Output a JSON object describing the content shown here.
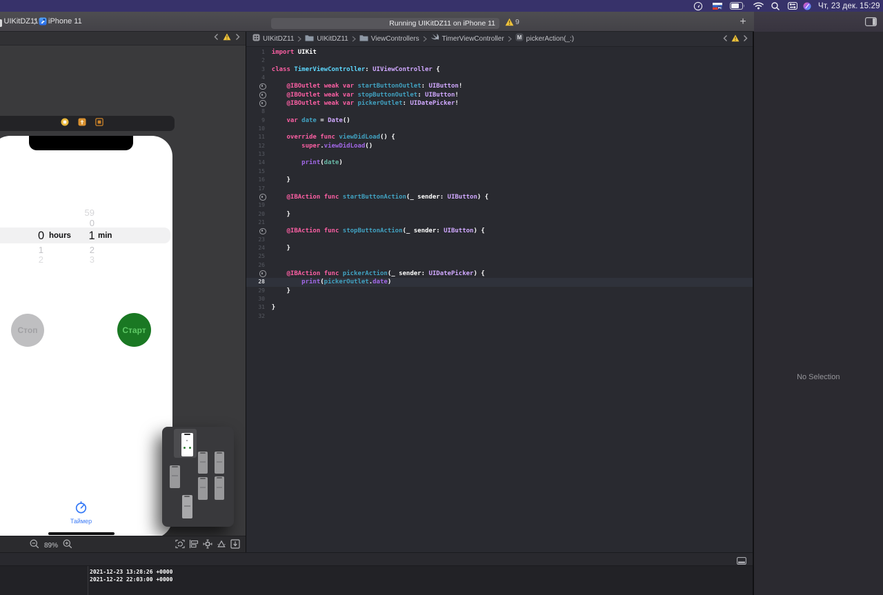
{
  "menubar": {
    "date": "Чт, 23 дек.",
    "time": "15:29",
    "flag_badge": "РС",
    "icons": [
      "location-icon",
      "input-flag-icon",
      "battery-icon",
      "wifi-icon",
      "spotlight-icon",
      "control-center-icon",
      "color-app-icon"
    ]
  },
  "toolbar": {
    "scheme": "UIKitDZ11",
    "device": "iPhone 11",
    "status": "Running UIKitDZ11 on iPhone 11",
    "warning_count": "9",
    "add_label": "+"
  },
  "ib": {
    "zoom": "89%",
    "scene": {
      "picker": {
        "hours_selected": "0",
        "hours_label": "hours",
        "minutes_selected": "1",
        "minutes_label": "min",
        "minutes_above": [
          "59",
          "0"
        ],
        "hours_below": [
          "1",
          "2"
        ],
        "minutes_below": [
          "2",
          "3"
        ]
      },
      "stop_label": "Стоп",
      "start_label": "Старт",
      "tab_label": "Таймер"
    }
  },
  "editor": {
    "breadcrumbs": [
      {
        "icon": "app-icon",
        "label": "UIKitDZ11"
      },
      {
        "icon": "folder-icon",
        "label": "UIKitDZ11"
      },
      {
        "icon": "folder-icon",
        "label": "ViewControllers"
      },
      {
        "icon": "swift-icon",
        "label": "TimerViewController"
      },
      {
        "icon": "method-icon",
        "label": "pickerAction(_:)",
        "badge": "M"
      }
    ],
    "current_line": 28,
    "lines": [
      {
        "n": 1,
        "t": [
          [
            "k",
            "import"
          ],
          [
            "p",
            " UIKit"
          ]
        ]
      },
      {
        "n": 2,
        "t": []
      },
      {
        "n": 3,
        "t": [
          [
            "k",
            "class"
          ],
          [
            "p",
            " "
          ],
          [
            "td",
            "TimerViewController"
          ],
          [
            "p",
            ": "
          ],
          [
            "t",
            "UIViewController"
          ],
          [
            "p",
            " {"
          ]
        ]
      },
      {
        "n": 4,
        "t": []
      },
      {
        "n": 5,
        "well": true,
        "t": [
          [
            "p",
            "    "
          ],
          [
            "k",
            "@IBOutlet"
          ],
          [
            "p",
            " "
          ],
          [
            "k",
            "weak"
          ],
          [
            "p",
            " "
          ],
          [
            "k",
            "var"
          ],
          [
            "p",
            " "
          ],
          [
            "d",
            "startButtonOutlet"
          ],
          [
            "p",
            ": "
          ],
          [
            "t",
            "UIButton"
          ],
          [
            "p",
            "!"
          ]
        ]
      },
      {
        "n": 6,
        "well": true,
        "t": [
          [
            "p",
            "    "
          ],
          [
            "k",
            "@IBOutlet"
          ],
          [
            "p",
            " "
          ],
          [
            "k",
            "weak"
          ],
          [
            "p",
            " "
          ],
          [
            "k",
            "var"
          ],
          [
            "p",
            " "
          ],
          [
            "d",
            "stopButtonOutlet"
          ],
          [
            "p",
            ": "
          ],
          [
            "t",
            "UIButton"
          ],
          [
            "p",
            "!"
          ]
        ]
      },
      {
        "n": 7,
        "well": true,
        "t": [
          [
            "p",
            "    "
          ],
          [
            "k",
            "@IBOutlet"
          ],
          [
            "p",
            " "
          ],
          [
            "k",
            "weak"
          ],
          [
            "p",
            " "
          ],
          [
            "k",
            "var"
          ],
          [
            "p",
            " "
          ],
          [
            "d",
            "pickerOutlet"
          ],
          [
            "p",
            ": "
          ],
          [
            "t",
            "UIDatePicker"
          ],
          [
            "p",
            "!"
          ]
        ]
      },
      {
        "n": 8,
        "t": []
      },
      {
        "n": 9,
        "t": [
          [
            "p",
            "    "
          ],
          [
            "k",
            "var"
          ],
          [
            "p",
            " "
          ],
          [
            "d",
            "date"
          ],
          [
            "p",
            " = "
          ],
          [
            "t",
            "Date"
          ],
          [
            "p",
            "()"
          ]
        ]
      },
      {
        "n": 10,
        "t": []
      },
      {
        "n": 11,
        "t": [
          [
            "p",
            "    "
          ],
          [
            "k",
            "override"
          ],
          [
            "p",
            " "
          ],
          [
            "k",
            "func"
          ],
          [
            "p",
            " "
          ],
          [
            "d",
            "viewDidLoad"
          ],
          [
            "p",
            "() {"
          ]
        ]
      },
      {
        "n": 12,
        "t": [
          [
            "p",
            "        "
          ],
          [
            "k",
            "super"
          ],
          [
            "p",
            "."
          ],
          [
            "c",
            "viewDidLoad"
          ],
          [
            "p",
            "()"
          ]
        ]
      },
      {
        "n": 13,
        "t": []
      },
      {
        "n": 14,
        "t": [
          [
            "p",
            "        "
          ],
          [
            "c",
            "print"
          ],
          [
            "p",
            "("
          ],
          [
            "r",
            "date"
          ],
          [
            "p",
            ")"
          ]
        ]
      },
      {
        "n": 15,
        "t": []
      },
      {
        "n": 16,
        "t": [
          [
            "p",
            "    }"
          ]
        ]
      },
      {
        "n": 17,
        "t": []
      },
      {
        "n": 18,
        "well": true,
        "t": [
          [
            "p",
            "    "
          ],
          [
            "k",
            "@IBAction"
          ],
          [
            "p",
            " "
          ],
          [
            "k",
            "func"
          ],
          [
            "p",
            " "
          ],
          [
            "d",
            "startButtonAction"
          ],
          [
            "p",
            "(_ sender: "
          ],
          [
            "t",
            "UIButton"
          ],
          [
            "p",
            ") {"
          ]
        ]
      },
      {
        "n": 19,
        "t": []
      },
      {
        "n": 20,
        "t": [
          [
            "p",
            "    }"
          ]
        ]
      },
      {
        "n": 21,
        "t": []
      },
      {
        "n": 22,
        "well": true,
        "t": [
          [
            "p",
            "    "
          ],
          [
            "k",
            "@IBAction"
          ],
          [
            "p",
            " "
          ],
          [
            "k",
            "func"
          ],
          [
            "p",
            " "
          ],
          [
            "d",
            "stopButtonAction"
          ],
          [
            "p",
            "(_ sender: "
          ],
          [
            "t",
            "UIButton"
          ],
          [
            "p",
            ") {"
          ]
        ]
      },
      {
        "n": 23,
        "t": []
      },
      {
        "n": 24,
        "t": [
          [
            "p",
            "    }"
          ]
        ]
      },
      {
        "n": 25,
        "t": []
      },
      {
        "n": 26,
        "t": []
      },
      {
        "n": 27,
        "well": true,
        "t": [
          [
            "p",
            "    "
          ],
          [
            "k",
            "@IBAction"
          ],
          [
            "p",
            " "
          ],
          [
            "k",
            "func"
          ],
          [
            "p",
            " "
          ],
          [
            "d",
            "pickerAction"
          ],
          [
            "p",
            "(_ sender: "
          ],
          [
            "t",
            "UIDatePicker"
          ],
          [
            "p",
            ") {"
          ]
        ]
      },
      {
        "n": 28,
        "cur": true,
        "t": [
          [
            "p",
            "        "
          ],
          [
            "c",
            "print"
          ],
          [
            "p",
            "("
          ],
          [
            "d",
            "pickerOutlet"
          ],
          [
            "p",
            "."
          ],
          [
            "c",
            "date"
          ],
          [
            "p",
            ")"
          ]
        ]
      },
      {
        "n": 29,
        "t": [
          [
            "p",
            "    }"
          ]
        ]
      },
      {
        "n": 30,
        "t": []
      },
      {
        "n": 31,
        "t": [
          [
            "p",
            "}"
          ]
        ]
      },
      {
        "n": 32,
        "t": []
      }
    ]
  },
  "inspector": {
    "empty_text": "No Selection"
  },
  "console": {
    "lines": [
      "2021-12-23 13:28:26 +0000",
      "2021-12-22 22:03:00 +0000"
    ]
  }
}
